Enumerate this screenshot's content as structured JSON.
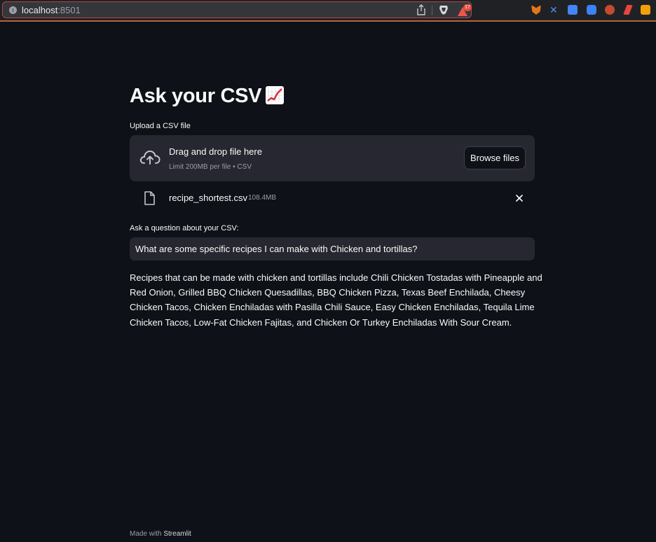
{
  "browser": {
    "url_host": "localhost",
    "url_port": ":8501",
    "rewards_badge": "17",
    "extensions": [
      "metamask-icon",
      "extension-icon",
      "translate-icon",
      "extension-icon",
      "extension-icon",
      "extension-icon",
      "brave-rewards-icon"
    ]
  },
  "app": {
    "title": "Ask your CSV",
    "title_emoji": "chart-increasing-icon",
    "uploader": {
      "label": "Upload a CSV file",
      "drop_text": "Drag and drop file here",
      "limit_text": "Limit 200MB per file • CSV",
      "browse_label": "Browse files"
    },
    "uploaded_file": {
      "name": "recipe_shortest.csv",
      "size": "108.4MB"
    },
    "question": {
      "label": "Ask a question about your CSV:",
      "value": "What are some specific recipes I can make with Chicken and tortillas?"
    },
    "answer": "Recipes that can be made with chicken and tortillas include Chili Chicken Tostadas with Pineapple and Red Onion, Grilled BBQ Chicken Quesadillas, BBQ Chicken Pizza, Texas Beef Enchilada, Cheesy Chicken Tacos, Chicken Enchiladas with Pasilla Chili Sauce, Easy Chicken Enchiladas, Tequila Lime Chicken Tacos, Low-Fat Chicken Fajitas, and Chicken Or Turkey Enchiladas With Sour Cream.",
    "footer": {
      "prefix": "Made with",
      "brand": "Streamlit"
    }
  },
  "colors": {
    "background": "#0e1117",
    "surface": "#262730",
    "text": "#fafafa",
    "muted": "#9c9ea5"
  }
}
